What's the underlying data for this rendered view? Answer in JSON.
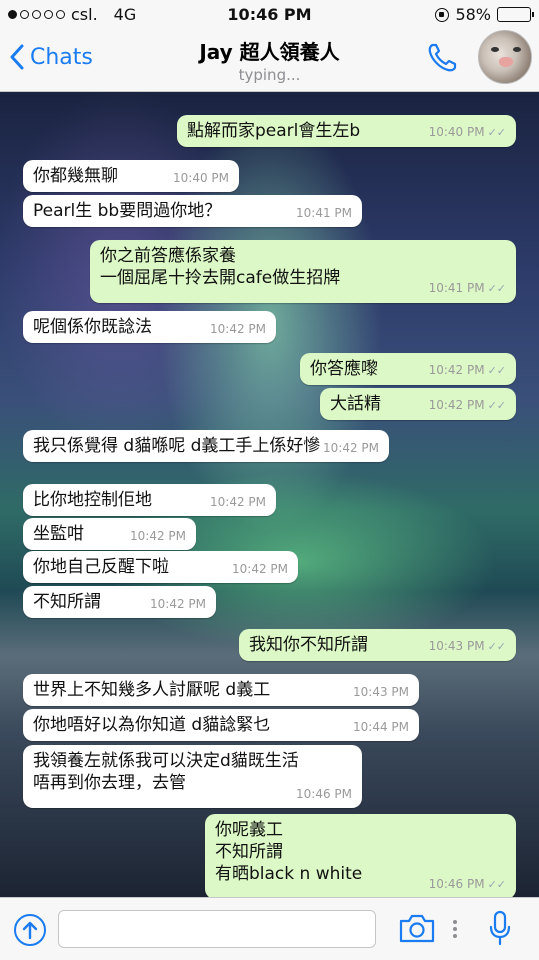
{
  "status_bar": {
    "carrier": "csl.",
    "network": "4G",
    "time": "10:46 PM",
    "battery": "58%",
    "battery_level": 0.58,
    "signal_dots_filled": 1,
    "icons": [
      "signal-dots-icon",
      "orientation-lock-icon",
      "battery-icon"
    ]
  },
  "nav": {
    "back_label": "Chats",
    "title": "Jay 超人領養人",
    "subtitle": "typing...",
    "accent_color": "#1a7cf0",
    "icons": [
      "chevron-left-icon",
      "phone-icon",
      "avatar"
    ]
  },
  "messages": [
    {
      "side": "out",
      "text": "點解而家pearl會生左b",
      "time": "10:40 PM"
    },
    {
      "side": "in",
      "text": "你都幾無聊",
      "time": "10:40 PM"
    },
    {
      "side": "in",
      "text": "Pearl生 bb要問過你地？",
      "time": "10:41 PM"
    },
    {
      "side": "out",
      "text": "你之前答應係家養\n一個屈尾十拎去開cafe做生招牌",
      "time": "10:41 PM"
    },
    {
      "side": "in",
      "text": "呢個係你既諗法",
      "time": "10:42 PM"
    },
    {
      "side": "out",
      "text": "你答應嚟",
      "time": "10:42 PM"
    },
    {
      "side": "out",
      "text": "大話精",
      "time": "10:42 PM"
    },
    {
      "side": "in",
      "text": "我只係覺得 d貓喺呢 d義工手上係好慘",
      "time": "10:42 PM"
    },
    {
      "side": "in",
      "text": "比你地控制佢地",
      "time": "10:42 PM"
    },
    {
      "side": "in",
      "text": "坐監咁",
      "time": "10:42 PM"
    },
    {
      "side": "in",
      "text": "你地自己反醒下啦",
      "time": "10:42 PM"
    },
    {
      "side": "in",
      "text": "不知所謂",
      "time": "10:42 PM"
    },
    {
      "side": "out",
      "text": "我知你不知所謂",
      "time": "10:43 PM"
    },
    {
      "side": "in",
      "text": "世界上不知幾多人討厭呢 d義工",
      "time": "10:43 PM"
    },
    {
      "side": "in",
      "text": "你地唔好以為你知道 d貓諗緊乜",
      "time": "10:44 PM"
    },
    {
      "side": "in",
      "text": "我領養左就係我可以決定d貓既生活\n唔再到你去理，去管",
      "time": "10:46 PM"
    },
    {
      "side": "out",
      "text": "你呢義工\n不知所謂\n有晒black n white",
      "time": "10:46 PM"
    }
  ],
  "input_bar": {
    "placeholder": "",
    "icons": [
      "upload-icon",
      "camera-icon",
      "more-dots-icon",
      "microphone-icon"
    ]
  },
  "colors": {
    "incoming_bubble": "#ffffff",
    "outgoing_bubble": "#dcf8c6",
    "timestamp": "#9a9a9a"
  }
}
